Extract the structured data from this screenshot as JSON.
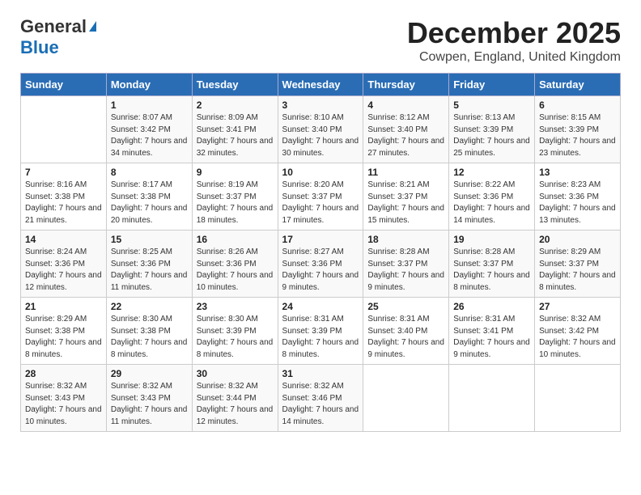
{
  "logo": {
    "line1": "General",
    "icon": "▲",
    "line2": "Blue"
  },
  "title": "December 2025",
  "location": "Cowpen, England, United Kingdom",
  "days_of_week": [
    "Sunday",
    "Monday",
    "Tuesday",
    "Wednesday",
    "Thursday",
    "Friday",
    "Saturday"
  ],
  "weeks": [
    [
      {
        "day": "",
        "content": ""
      },
      {
        "day": "1",
        "content": "Sunrise: 8:07 AM\nSunset: 3:42 PM\nDaylight: 7 hours\nand 34 minutes."
      },
      {
        "day": "2",
        "content": "Sunrise: 8:09 AM\nSunset: 3:41 PM\nDaylight: 7 hours\nand 32 minutes."
      },
      {
        "day": "3",
        "content": "Sunrise: 8:10 AM\nSunset: 3:40 PM\nDaylight: 7 hours\nand 30 minutes."
      },
      {
        "day": "4",
        "content": "Sunrise: 8:12 AM\nSunset: 3:40 PM\nDaylight: 7 hours\nand 27 minutes."
      },
      {
        "day": "5",
        "content": "Sunrise: 8:13 AM\nSunset: 3:39 PM\nDaylight: 7 hours\nand 25 minutes."
      },
      {
        "day": "6",
        "content": "Sunrise: 8:15 AM\nSunset: 3:39 PM\nDaylight: 7 hours\nand 23 minutes."
      }
    ],
    [
      {
        "day": "7",
        "content": "Sunrise: 8:16 AM\nSunset: 3:38 PM\nDaylight: 7 hours\nand 21 minutes."
      },
      {
        "day": "8",
        "content": "Sunrise: 8:17 AM\nSunset: 3:38 PM\nDaylight: 7 hours\nand 20 minutes."
      },
      {
        "day": "9",
        "content": "Sunrise: 8:19 AM\nSunset: 3:37 PM\nDaylight: 7 hours\nand 18 minutes."
      },
      {
        "day": "10",
        "content": "Sunrise: 8:20 AM\nSunset: 3:37 PM\nDaylight: 7 hours\nand 17 minutes."
      },
      {
        "day": "11",
        "content": "Sunrise: 8:21 AM\nSunset: 3:37 PM\nDaylight: 7 hours\nand 15 minutes."
      },
      {
        "day": "12",
        "content": "Sunrise: 8:22 AM\nSunset: 3:36 PM\nDaylight: 7 hours\nand 14 minutes."
      },
      {
        "day": "13",
        "content": "Sunrise: 8:23 AM\nSunset: 3:36 PM\nDaylight: 7 hours\nand 13 minutes."
      }
    ],
    [
      {
        "day": "14",
        "content": "Sunrise: 8:24 AM\nSunset: 3:36 PM\nDaylight: 7 hours\nand 12 minutes."
      },
      {
        "day": "15",
        "content": "Sunrise: 8:25 AM\nSunset: 3:36 PM\nDaylight: 7 hours\nand 11 minutes."
      },
      {
        "day": "16",
        "content": "Sunrise: 8:26 AM\nSunset: 3:36 PM\nDaylight: 7 hours\nand 10 minutes."
      },
      {
        "day": "17",
        "content": "Sunrise: 8:27 AM\nSunset: 3:36 PM\nDaylight: 7 hours\nand 9 minutes."
      },
      {
        "day": "18",
        "content": "Sunrise: 8:28 AM\nSunset: 3:37 PM\nDaylight: 7 hours\nand 9 minutes."
      },
      {
        "day": "19",
        "content": "Sunrise: 8:28 AM\nSunset: 3:37 PM\nDaylight: 7 hours\nand 8 minutes."
      },
      {
        "day": "20",
        "content": "Sunrise: 8:29 AM\nSunset: 3:37 PM\nDaylight: 7 hours\nand 8 minutes."
      }
    ],
    [
      {
        "day": "21",
        "content": "Sunrise: 8:29 AM\nSunset: 3:38 PM\nDaylight: 7 hours\nand 8 minutes."
      },
      {
        "day": "22",
        "content": "Sunrise: 8:30 AM\nSunset: 3:38 PM\nDaylight: 7 hours\nand 8 minutes."
      },
      {
        "day": "23",
        "content": "Sunrise: 8:30 AM\nSunset: 3:39 PM\nDaylight: 7 hours\nand 8 minutes."
      },
      {
        "day": "24",
        "content": "Sunrise: 8:31 AM\nSunset: 3:39 PM\nDaylight: 7 hours\nand 8 minutes."
      },
      {
        "day": "25",
        "content": "Sunrise: 8:31 AM\nSunset: 3:40 PM\nDaylight: 7 hours\nand 9 minutes."
      },
      {
        "day": "26",
        "content": "Sunrise: 8:31 AM\nSunset: 3:41 PM\nDaylight: 7 hours\nand 9 minutes."
      },
      {
        "day": "27",
        "content": "Sunrise: 8:32 AM\nSunset: 3:42 PM\nDaylight: 7 hours\nand 10 minutes."
      }
    ],
    [
      {
        "day": "28",
        "content": "Sunrise: 8:32 AM\nSunset: 3:43 PM\nDaylight: 7 hours\nand 10 minutes."
      },
      {
        "day": "29",
        "content": "Sunrise: 8:32 AM\nSunset: 3:43 PM\nDaylight: 7 hours\nand 11 minutes."
      },
      {
        "day": "30",
        "content": "Sunrise: 8:32 AM\nSunset: 3:44 PM\nDaylight: 7 hours\nand 12 minutes."
      },
      {
        "day": "31",
        "content": "Sunrise: 8:32 AM\nSunset: 3:46 PM\nDaylight: 7 hours\nand 14 minutes."
      },
      {
        "day": "",
        "content": ""
      },
      {
        "day": "",
        "content": ""
      },
      {
        "day": "",
        "content": ""
      }
    ]
  ]
}
